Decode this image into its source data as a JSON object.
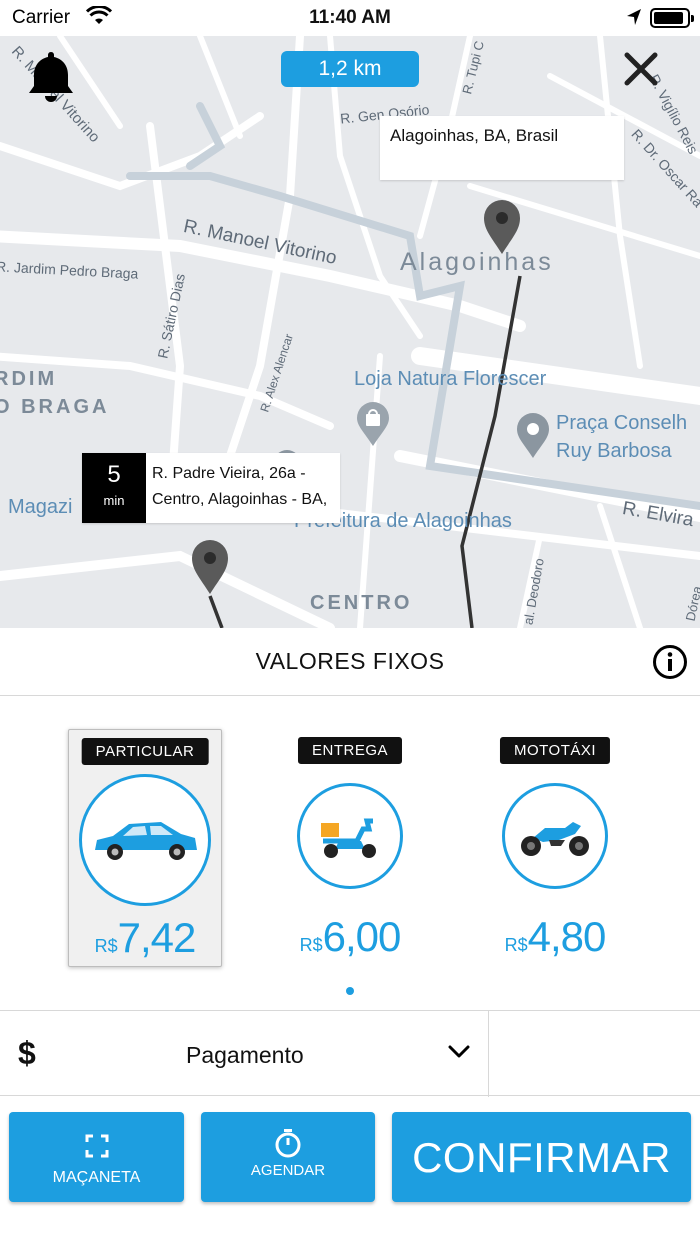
{
  "status_bar": {
    "carrier": "Carrier",
    "time": "11:40 AM",
    "battery_level": 0.92
  },
  "map": {
    "distance": "1,2 km",
    "destination_address": "Alagoinhas, BA, Brasil",
    "origin_eta_value": "5",
    "origin_eta_unit": "min",
    "origin_address": "R. Padre Vieira, 26a - Centro, Alagoinhas - BA,",
    "labels": {
      "city": "Alagoinhas",
      "manoel_vitorino": "R. Manoel Vitorino",
      "manoel_vitorino_2": "R. Manoel Vitorino",
      "jardim_pedro_braga": "R. Jardim Pedro Braga",
      "satiro_dias": "R. Sátiro Dias",
      "alex_alencar": "R. Alex Alencar",
      "gen_osorio": "R. Gen Osório",
      "tupi": "R. Tupi C",
      "vigilio_reis": "R. Vigílio Reis",
      "dr_oscar": "R. Dr. Oscar Ra",
      "elvira": "R. Elvira",
      "deodoro": "al. Deodoro",
      "dorea": "Dórea",
      "rdim": "RDIM",
      "o_braga": "O BRAGA",
      "centro": "CENTRO",
      "magazi": "Magazi",
      "loja_natura": "Loja Natura Florescer",
      "praca_l1": "Praça Conselh",
      "praca_l2": "Ruy Barbosa",
      "prefeitura": "Prefeitura de Alagoinhas"
    }
  },
  "section_title": "VALORES FIXOS",
  "vehicles": [
    {
      "tag": "PARTICULAR",
      "currency": "R$",
      "price": "7,42",
      "icon": "car-icon",
      "selected": true
    },
    {
      "tag": "ENTREGA",
      "currency": "R$",
      "price": "6,00",
      "icon": "delivery-scooter-icon",
      "selected": false
    },
    {
      "tag": "MOTOTÁXI",
      "currency": "R$",
      "price": "4,80",
      "icon": "motorcycle-icon",
      "selected": false
    }
  ],
  "payment": {
    "symbol": "$",
    "label": "Pagamento"
  },
  "actions": {
    "macaneta_label": "MAÇANETA",
    "agendar_label": "AGENDAR",
    "confirm_label": "CONFIRMAR"
  },
  "colors": {
    "accent": "#1d9ee0",
    "dark": "#111111",
    "map_bg": "#e7e9ec",
    "route": "#333333"
  }
}
